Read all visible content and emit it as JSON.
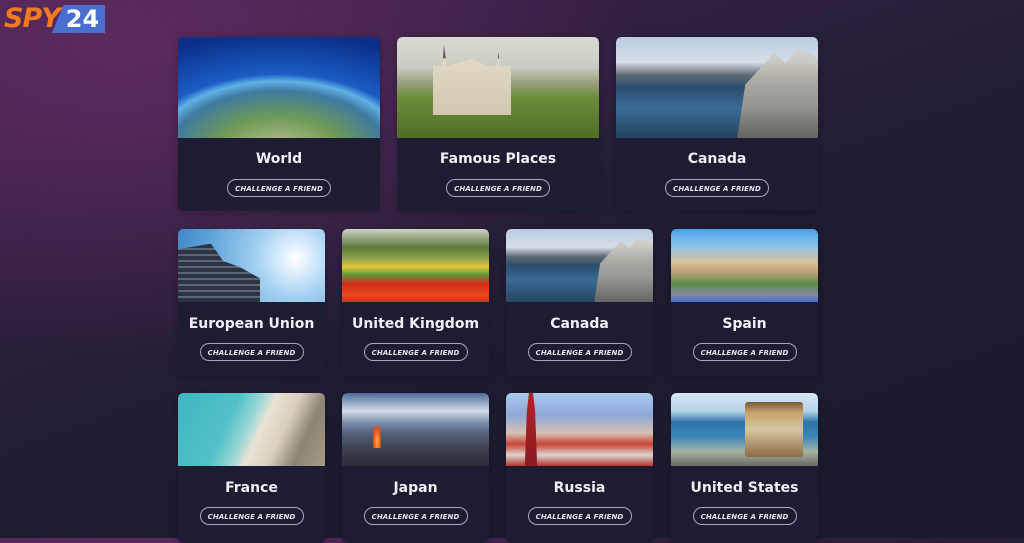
{
  "logo": {
    "brand_text": "SPY",
    "brand_number": "24",
    "colors": {
      "spy": "#f47a20",
      "number_bg": "#4a6fd1"
    }
  },
  "theme": {
    "background_top": "#5c2a5e",
    "background_bottom": "#1c1a2d",
    "card_background": "#1e1c33",
    "button_border": "#a9a7be"
  },
  "cards": [
    {
      "title": "World",
      "button_label": "CHALLENGE A FRIEND",
      "image": "earth-globe"
    },
    {
      "title": "Famous Places",
      "button_label": "CHALLENGE A FRIEND",
      "image": "castle-neuschwanstein"
    },
    {
      "title": "Canada",
      "button_label": "CHALLENGE A FRIEND",
      "image": "vancouver-harbour"
    },
    {
      "title": "European Union",
      "button_label": "CHALLENGE A FRIEND",
      "image": "eu-parliament-flags"
    },
    {
      "title": "United Kingdom",
      "button_label": "CHALLENGE A FRIEND",
      "image": "flower-garden"
    },
    {
      "title": "Canada",
      "button_label": "CHALLENGE A FRIEND",
      "image": "vancouver-harbour"
    },
    {
      "title": "Spain",
      "button_label": "CHALLENGE A FRIEND",
      "image": "park-guell"
    },
    {
      "title": "France",
      "button_label": "CHALLENGE A FRIEND",
      "image": "nice-beach"
    },
    {
      "title": "Japan",
      "button_label": "CHALLENGE A FRIEND",
      "image": "tokyo-tower-skyline"
    },
    {
      "title": "Russia",
      "button_label": "CHALLENGE A FRIEND",
      "image": "saint-basils-cathedral"
    },
    {
      "title": "United States",
      "button_label": "CHALLENGE A FRIEND",
      "image": "san-francisco-cable-car"
    }
  ]
}
